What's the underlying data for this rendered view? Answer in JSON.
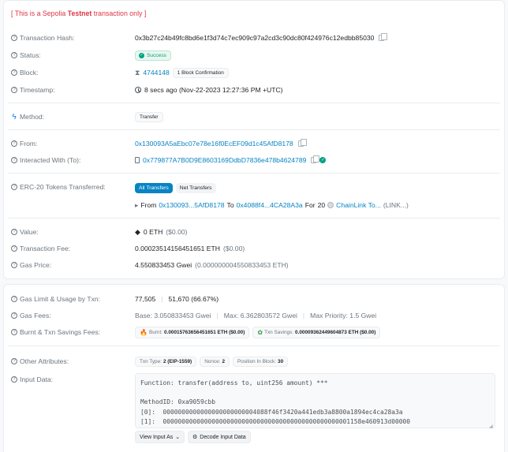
{
  "notice": {
    "prefix": "[ This is a Sepolia ",
    "network": "Testnet",
    "suffix": " transaction only ]"
  },
  "tx_hash": {
    "label": "Transaction Hash:",
    "value": "0x3b27c24b49fc8bd6e1f3d74c7ec909c97a2cd3c90dc80f424976c12edbb85030"
  },
  "status": {
    "label": "Status:",
    "value": "Success"
  },
  "block": {
    "label": "Block:",
    "number": "4744148",
    "confirmations": "1 Block Confirmation"
  },
  "timestamp": {
    "label": "Timestamp:",
    "value": "8 secs ago (Nov-22-2023 12:27:36 PM +UTC)"
  },
  "method": {
    "label": "Method:",
    "value": "Transfer"
  },
  "from": {
    "label": "From:",
    "value": "0x130093A5aEbc07e78e16f0EcEF09d1c45AfD8178"
  },
  "interacted": {
    "label": "Interacted With (To):",
    "value": "0x779877A7B0D9E8603169DdbD7836e478b4624789"
  },
  "erc20": {
    "label": "ERC-20 Tokens Transferred:",
    "tab_all": "All Transfers",
    "tab_net": "Net Transfers",
    "from_word": "From",
    "from_addr": "0x130093...5AfD8178",
    "to_word": "To",
    "to_addr": "0x4088f4...4CA28A3a",
    "for_word": "For",
    "amount": "20",
    "token_name": "ChainLink To...",
    "token_symbol": "(LINK...)"
  },
  "value": {
    "label": "Value:",
    "amount": "0 ETH",
    "usd": "($0.00)"
  },
  "fee": {
    "label": "Transaction Fee:",
    "amount": "0.00023514156451651 ETH",
    "usd": "($0.00)"
  },
  "gas_price": {
    "label": "Gas Price:",
    "gwei": "4.550833453 Gwei",
    "eth": "(0.000000004550833453 ETH)"
  },
  "gas_limit": {
    "label": "Gas Limit & Usage by Txn:",
    "limit": "77,505",
    "usage": "51,670 (66.67%)"
  },
  "gas_fees": {
    "label": "Gas Fees:",
    "base": "Base: 3.050833453 Gwei",
    "max": "Max: 6.362803572 Gwei",
    "priority": "Max Priority: 1.5 Gwei"
  },
  "burnt": {
    "label": "Burnt & Txn Savings Fees:",
    "burnt_prefix": "Burnt:",
    "burnt_value": "0.00015763656451651 ETH ($0.00)",
    "savings_prefix": "Txn Savings:",
    "savings_value": "0.00009362449604873 ETH ($0.00)"
  },
  "other": {
    "label": "Other Attributes:",
    "txn_type_label": "Txn Type:",
    "txn_type_value": "2 (EIP-1559)",
    "nonce_label": "Nonce:",
    "nonce_value": "2",
    "position_label": "Position In Block:",
    "position_value": "30"
  },
  "input": {
    "label": "Input Data:",
    "code": "Function: transfer(address to, uint256 amount) ***\n\nMethodID: 0xa9059cbb\n[0]:  0000000000000000000000004088f46f3420a441edb3a8800a1894ec4ca28a3a\n[1]:  00000000000000000000000000000000000000000000000001158e460913d00000",
    "view_as": "View Input As",
    "decode": "Decode Input Data"
  },
  "colors": {
    "link": "#0784c3",
    "success": "#00a186",
    "notice": "#dc3545"
  }
}
